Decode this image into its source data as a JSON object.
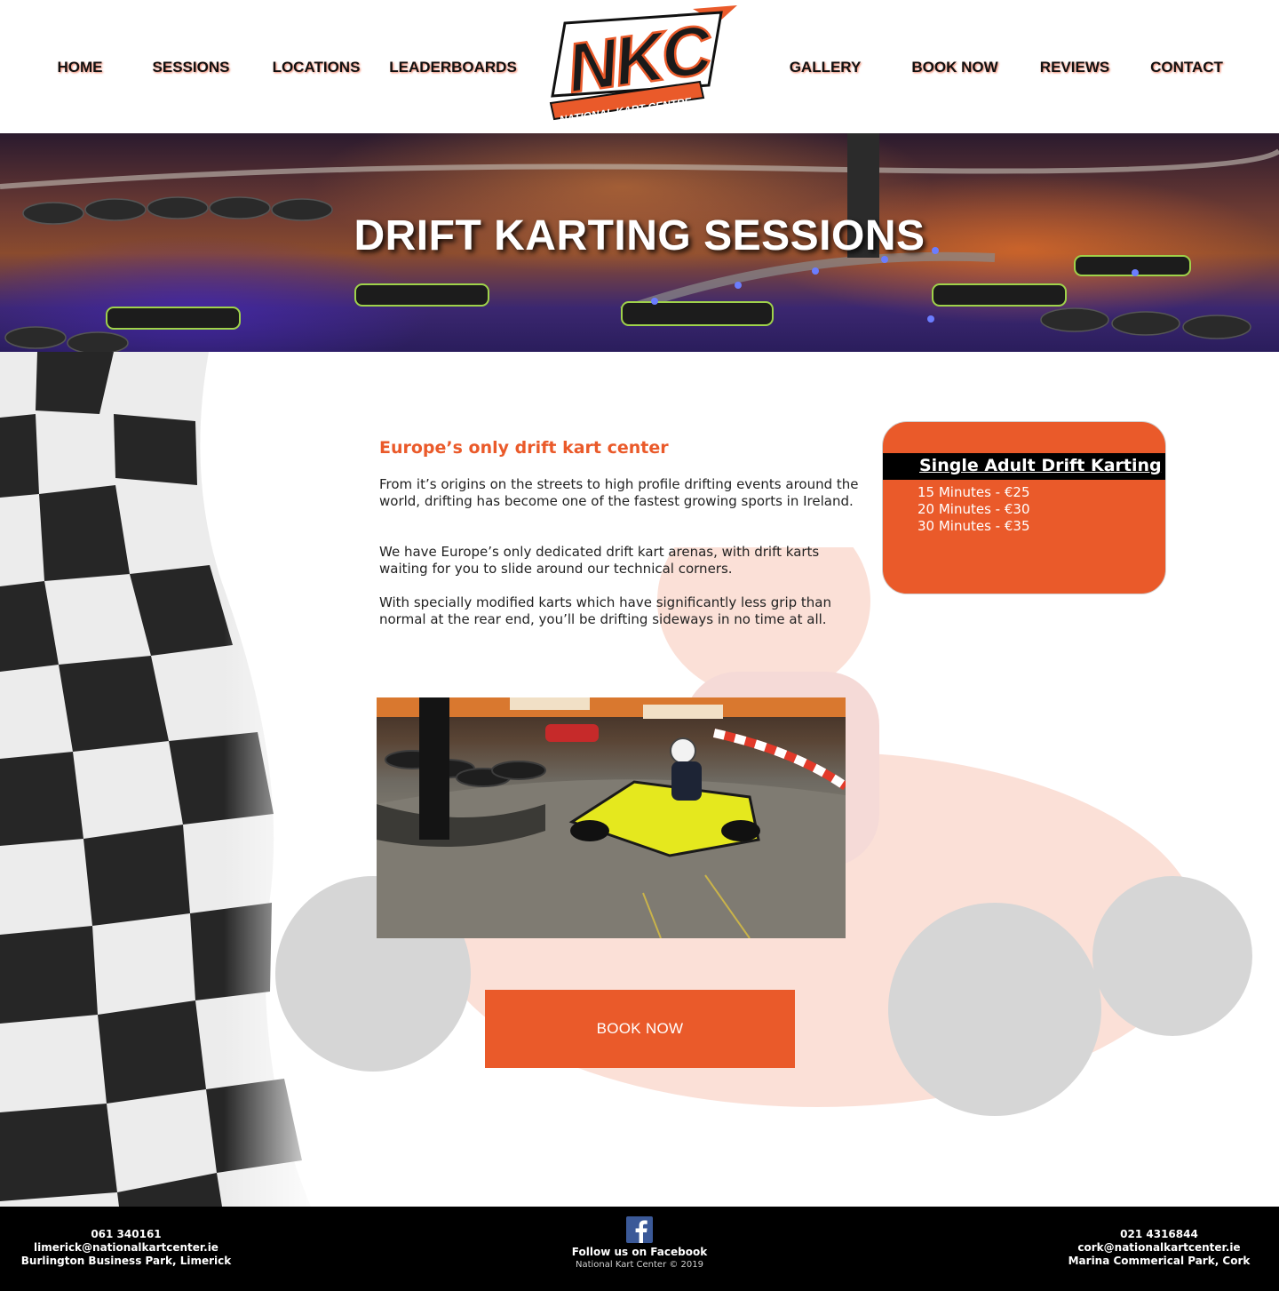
{
  "nav": {
    "home": "HOME",
    "sessions": "SESSIONS",
    "locations": "LOCATIONS",
    "leaderboards": "LEADERBOARDS",
    "gallery": "GALLERY",
    "book_now": "BOOK NOW",
    "reviews": "REVIEWS",
    "contact": "CONTACT"
  },
  "logo": {
    "letters": "NKC",
    "tagline": "NATIONAL KART CENTRE"
  },
  "hero": {
    "title": "DRIFT KARTING SESSIONS"
  },
  "intro": {
    "heading": "Europe’s only drift kart center",
    "paragraphs": [
      "From it’s origins on the streets to high profile drifting events around the world, drifting has become one of the fastest growing sports in Ireland.",
      "We have Europe’s only dedicated drift kart arenas, with drift karts waiting for you to slide around our technical corners.",
      "With specially modified karts which have significantly less grip than normal at the rear end, you’ll be drifting sideways in no time at all."
    ]
  },
  "pricing": {
    "title": "Single Adult Drift Karting",
    "items": [
      "15 Minutes - €25",
      "20 Minutes - €30",
      "30 Minutes - €35"
    ]
  },
  "book_button": "BOOK NOW",
  "footer": {
    "limerick": {
      "phone": "061 340161",
      "email": "limerick@nationalkartcenter.ie",
      "address": "Burlington Business Park, Limerick"
    },
    "facebook_label": "Follow us on Facebook",
    "copyright": "National Kart Center © 2019",
    "cork": {
      "phone": "021 4316844",
      "email": "cork@nationalkartcenter.ie",
      "address": "Marina Commerical Park, Cork"
    }
  },
  "colors": {
    "accent": "#ea5a2a",
    "footer_bg": "#000000",
    "facebook": "#3b5998"
  }
}
